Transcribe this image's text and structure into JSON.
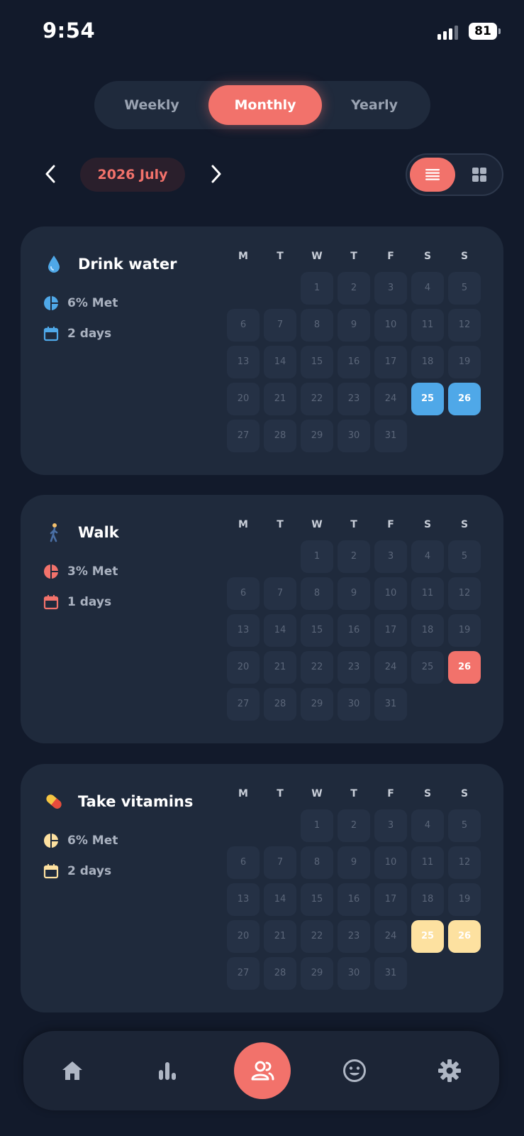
{
  "status_bar": {
    "time": "9:54",
    "battery": "81"
  },
  "tabs": [
    {
      "label": "Weekly",
      "active": false
    },
    {
      "label": "Monthly",
      "active": true
    },
    {
      "label": "Yearly",
      "active": false
    }
  ],
  "month_nav": {
    "label": "2026 July",
    "prev_icon": "chevron-left-icon",
    "next_icon": "chevron-right-icon"
  },
  "view_toggle": {
    "selected": "list",
    "options": [
      "list",
      "grid"
    ]
  },
  "weekday_headers": [
    "M",
    "T",
    "W",
    "T",
    "F",
    "S",
    "S"
  ],
  "month": {
    "first_weekday_index": 2,
    "days_in_month": 31
  },
  "habits": [
    {
      "name": "Drink water",
      "icon": "water-drop-icon",
      "color": "#4fa8e8",
      "met": "6% Met",
      "met_fraction": 0.06,
      "days": "2 days",
      "completed_days": [
        25,
        26
      ]
    },
    {
      "name": "Walk",
      "icon": "walking-person-icon",
      "color": "#f2726b",
      "met": "3% Met",
      "met_fraction": 0.03,
      "days": "1 days",
      "completed_days": [
        26
      ]
    },
    {
      "name": "Take vitamins",
      "icon": "pill-icon",
      "color": "#fde1a0",
      "met": "6% Met",
      "met_fraction": 0.06,
      "days": "2 days",
      "completed_days": [
        25,
        26
      ]
    }
  ],
  "bottom_nav": [
    {
      "name": "home",
      "icon": "home-icon"
    },
    {
      "name": "stats",
      "icon": "bar-chart-icon"
    },
    {
      "name": "community",
      "icon": "people-icon",
      "active": true
    },
    {
      "name": "mood",
      "icon": "smiley-icon"
    },
    {
      "name": "settings",
      "icon": "gear-icon"
    }
  ]
}
